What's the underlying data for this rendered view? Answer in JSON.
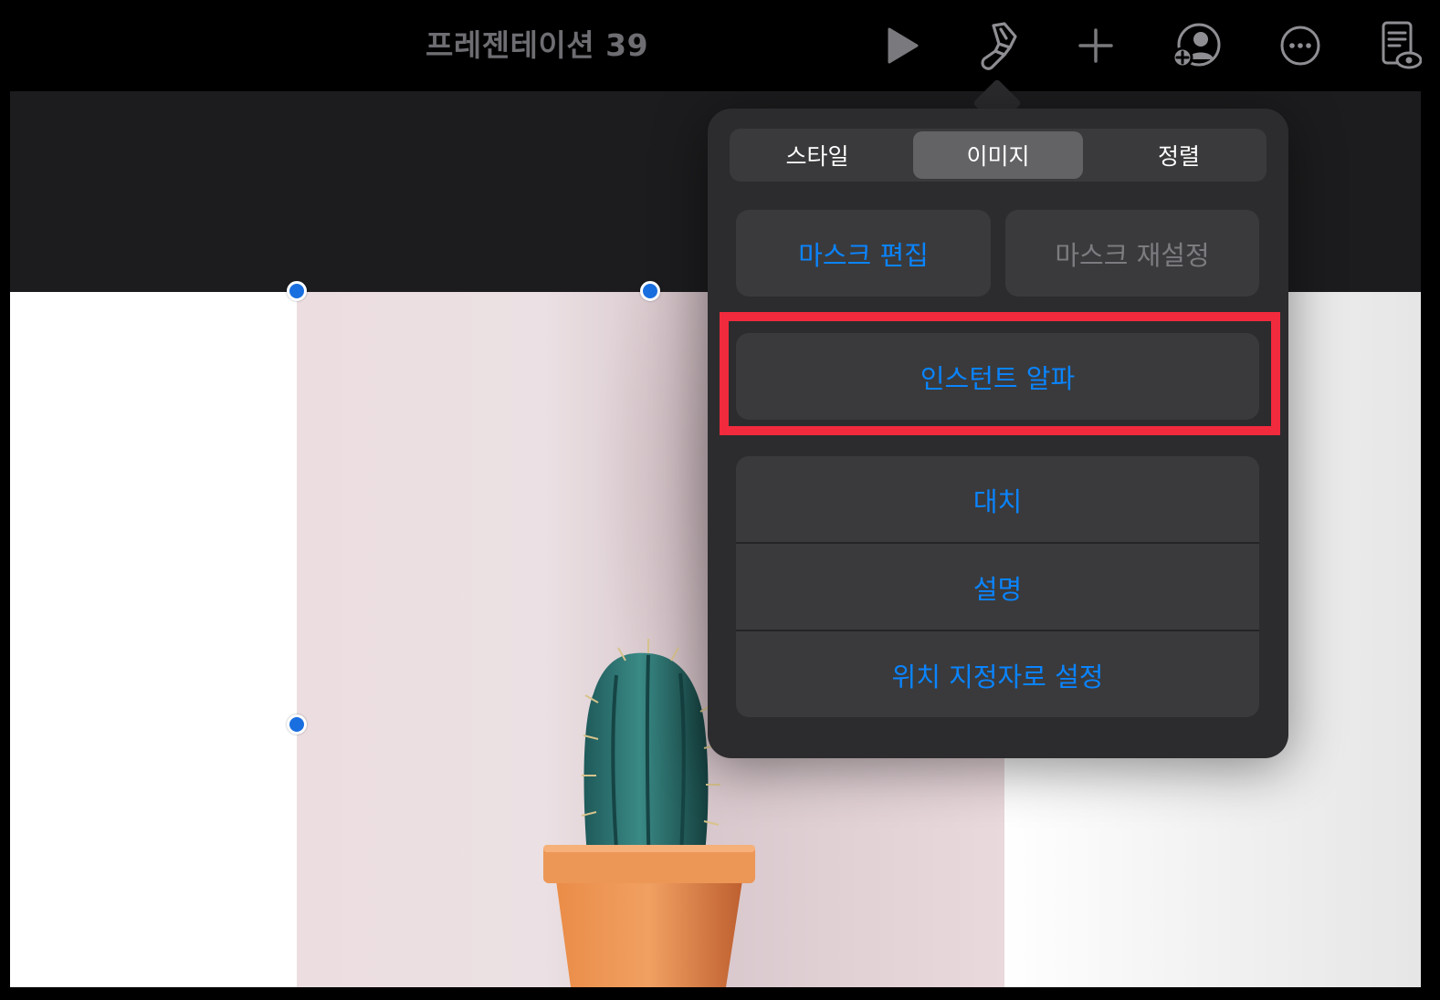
{
  "toolbar": {
    "title": "프레젠테이션 39",
    "icons": [
      "play-icon",
      "paintbrush-icon",
      "plus-icon",
      "add-person-icon",
      "more-icon",
      "reader-view-icon"
    ]
  },
  "popover": {
    "tabs": [
      {
        "label": "스타일",
        "active": false
      },
      {
        "label": "이미지",
        "active": true
      },
      {
        "label": "정렬",
        "active": false
      }
    ],
    "edit_mask": "마스크 편집",
    "reset_mask": "마스크 재설정",
    "instant_alpha": "인스턴트 알파",
    "actions": [
      "대치",
      "설명",
      "위치 지정자로 설정"
    ]
  },
  "colors": {
    "accent": "#0a84ff",
    "highlight": "#f22a3d",
    "handle": "#1a6fe0",
    "popover_bg": "#2c2c2e",
    "button_bg": "#3a3a3c"
  }
}
